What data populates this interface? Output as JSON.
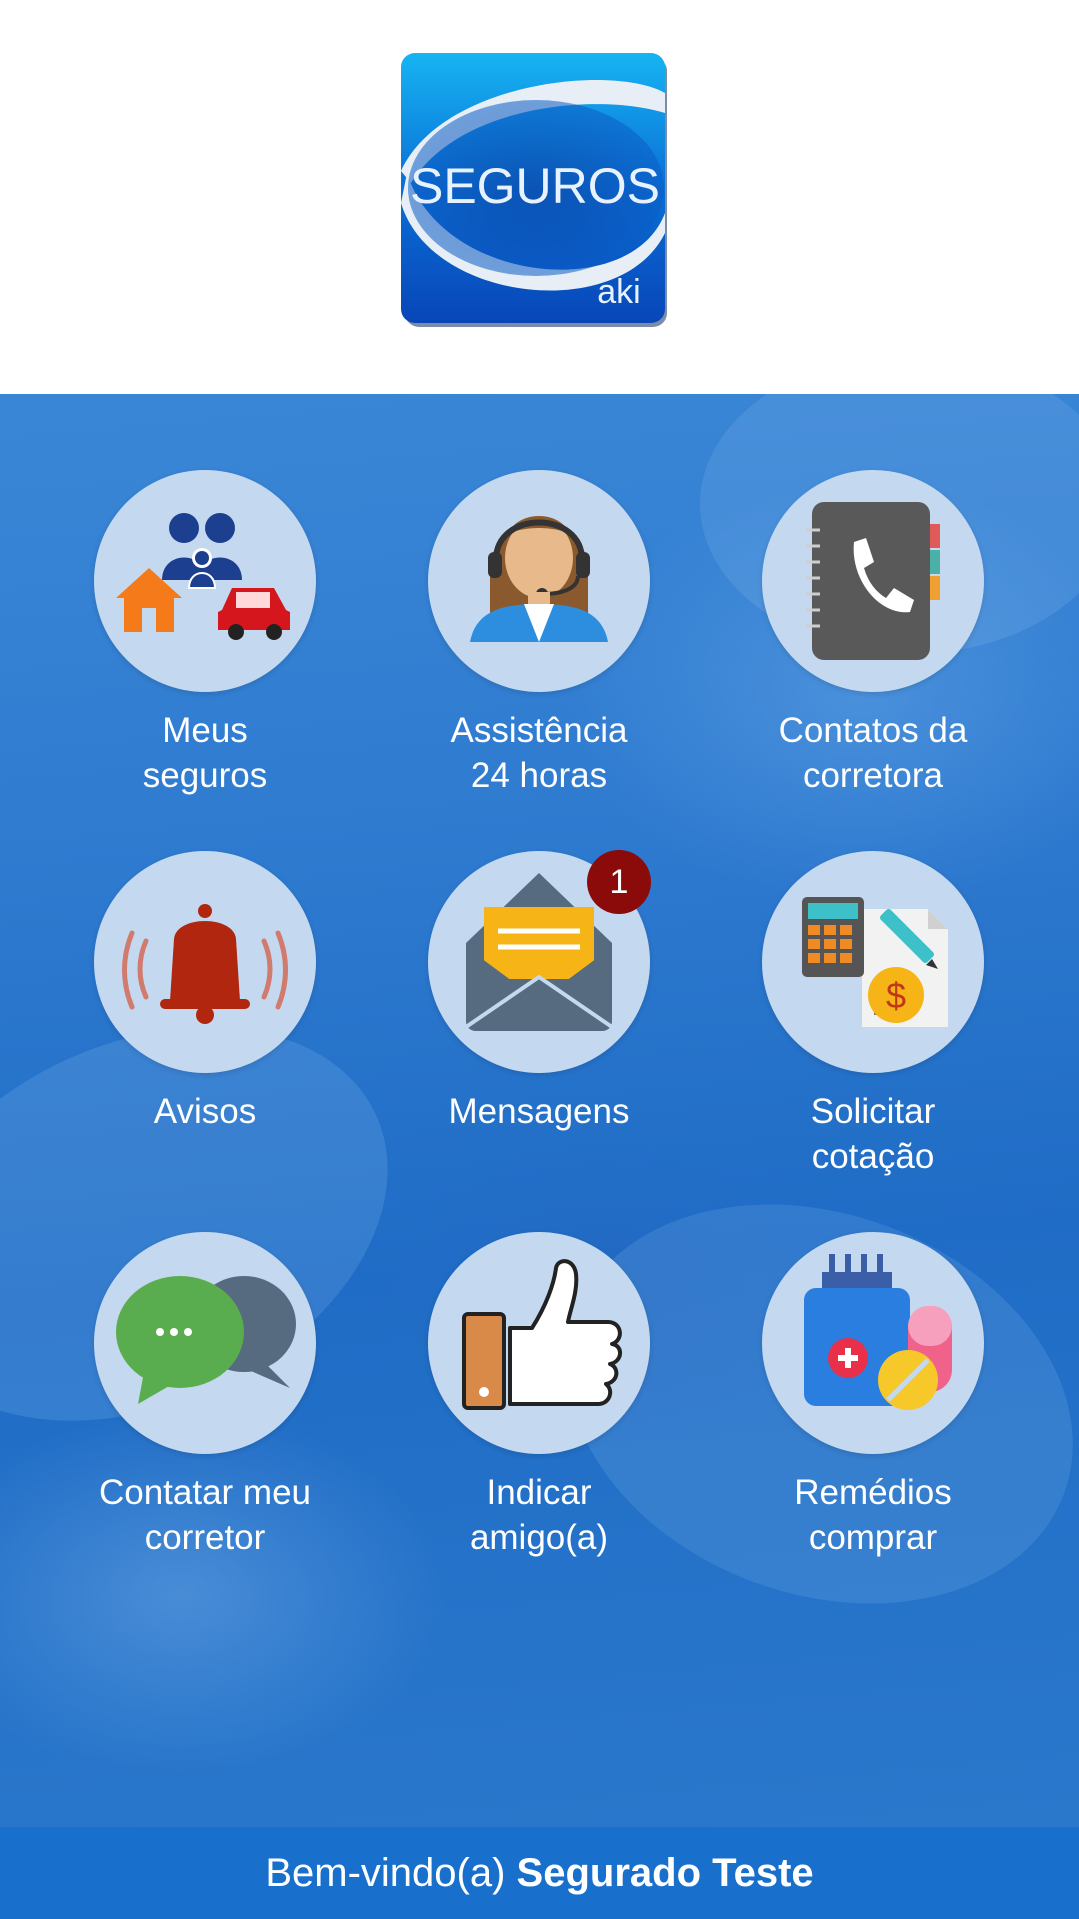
{
  "logo": {
    "main_text": "SEGUROS",
    "sub_text": "aki"
  },
  "menu": {
    "items": [
      {
        "label": "Meus\nseguros",
        "icon": "family-insurance-icon"
      },
      {
        "label": "Assistência\n24 horas",
        "icon": "headset-agent-icon"
      },
      {
        "label": "Contatos da\ncorretora",
        "icon": "phone-book-icon"
      },
      {
        "label": "Avisos",
        "icon": "bell-icon"
      },
      {
        "label": "Mensagens",
        "icon": "envelope-icon",
        "badge": "1"
      },
      {
        "label": "Solicitar\ncotação",
        "icon": "calculator-quote-icon"
      },
      {
        "label": "Contatar meu\ncorretor",
        "icon": "chat-bubbles-icon"
      },
      {
        "label": "Indicar\namigo(a)",
        "icon": "thumbs-up-icon"
      },
      {
        "label": "Remédios\ncomprar",
        "icon": "medicine-icon"
      }
    ]
  },
  "footer": {
    "greeting": "Bem-vindo(a)",
    "user_name": "Segurado Teste"
  },
  "colors": {
    "brand_blue": "#1870cc",
    "circle_bg": "#c4d9f0",
    "badge_red": "#8b0a0a"
  }
}
